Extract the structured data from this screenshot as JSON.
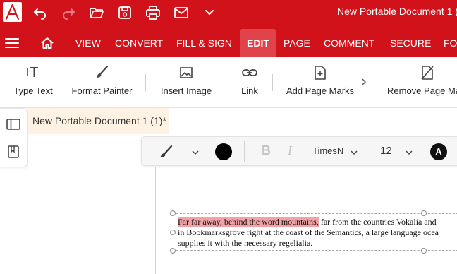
{
  "app": {
    "logo_letter": "A",
    "document_title": "New Portable Document 1 ("
  },
  "quick_access": {
    "icons": [
      "undo-icon",
      "redo-icon",
      "open-folder-icon",
      "save-icon",
      "print-icon",
      "email-icon",
      "chevron-down-icon"
    ]
  },
  "menu": {
    "tabs": [
      "VIEW",
      "CONVERT",
      "FILL & SIGN",
      "EDIT",
      "PAGE",
      "COMMENT",
      "SECURE",
      "FO"
    ],
    "active": "EDIT"
  },
  "ribbon": {
    "tools": [
      "Type Text",
      "Format Painter",
      "Insert Image",
      "Link",
      "Add Page Marks",
      "Remove Page Ma"
    ]
  },
  "document_tab": {
    "label": "New Portable Document 1 (1)*"
  },
  "format_bar": {
    "font_name": "TimesN",
    "font_size": "12",
    "text_color": "#000000",
    "font_style_badge": "A"
  },
  "textbox": {
    "line1_highlight": "Far far away, behind the word mountains,",
    "line1_rest": " far from the countries Vokalia and",
    "line2": "in Bookmarksgrove right at the coast of the Semantics, a large language ocea",
    "line3": "supplies it with the necessary regelialia."
  },
  "colors": {
    "brand_red": "#d1121a",
    "active_tab": "#e0434a",
    "highlight": "#f2a2a4",
    "doc_tab_bg": "#fdf2e4"
  }
}
